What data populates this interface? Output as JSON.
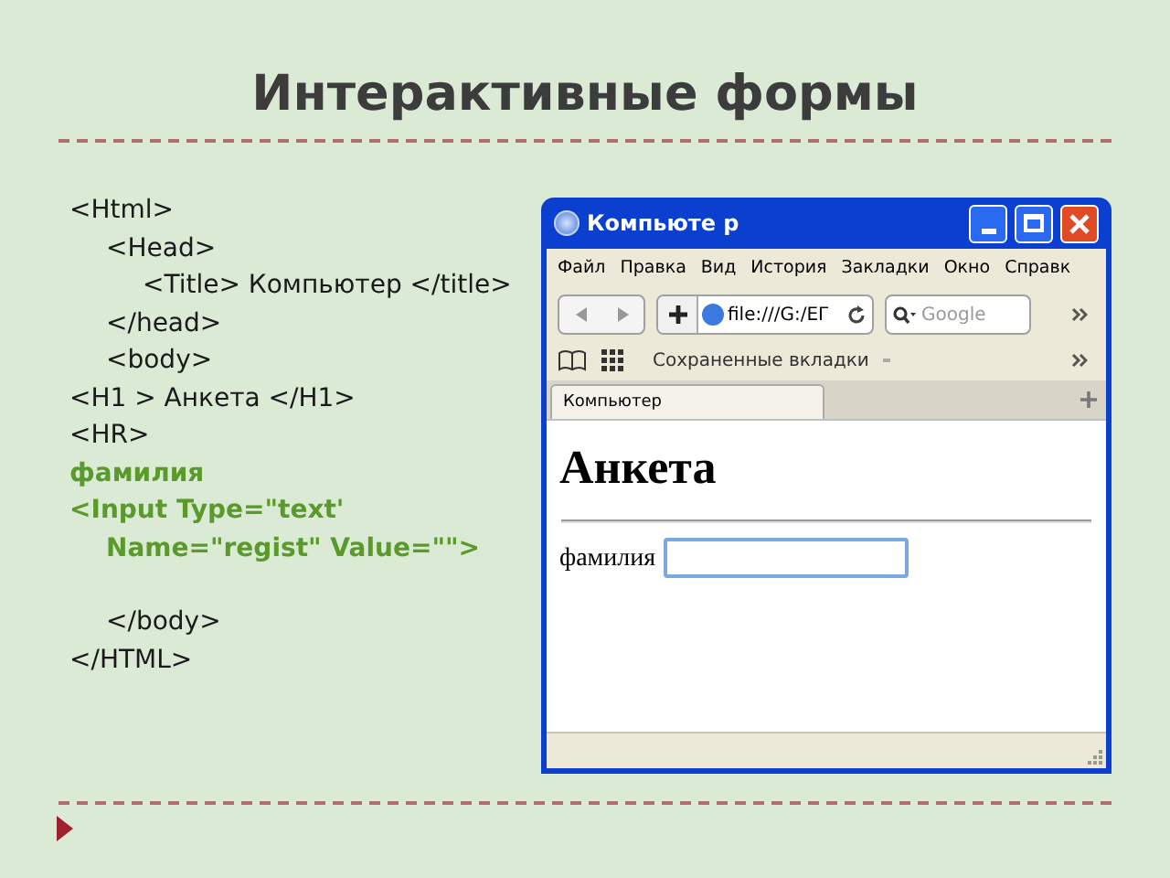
{
  "slide_title": "Интерактивные формы",
  "code_lines": [
    {
      "text": "<Html>",
      "kind": "tag",
      "children": [
        {
          "text": "<Head>",
          "kind": "tag",
          "children": [
            {
              "text": "<Title> Компьютер </title>",
              "kind": "tag"
            }
          ]
        },
        {
          "text": "</head>",
          "kind": "tag"
        },
        {
          "text": "<body>",
          "kind": "tag"
        }
      ]
    },
    {
      "text": "<H1 > Анкета </H1>",
      "kind": "tag"
    },
    {
      "text": "<HR>",
      "kind": "tag"
    },
    {
      "text": "фамилия",
      "kind": "highlight"
    },
    {
      "text": "<Input Type=\"text'",
      "kind": "highlight",
      "children": [
        {
          "text": "Name=\"regist\" Value=\"\">",
          "kind": "highlight"
        },
        {
          "text": "</body>",
          "kind": "tag",
          "spaced": true
        }
      ]
    },
    {
      "text": "</HTML>",
      "kind": "tag"
    }
  ],
  "browser": {
    "title": "Компьюте р",
    "menu": [
      "Файл",
      "Правка",
      "Вид",
      "История",
      "Закладки",
      "Окно",
      "Справк"
    ],
    "address": "file:///G:/EГ",
    "search_placeholder": "Google",
    "bookmarks_label": "Сохраненные вкладки",
    "tabs": [
      {
        "label": "Компьютер",
        "selected": true
      }
    ],
    "page": {
      "heading": "Анкета",
      "field_label": "фамилия"
    }
  }
}
